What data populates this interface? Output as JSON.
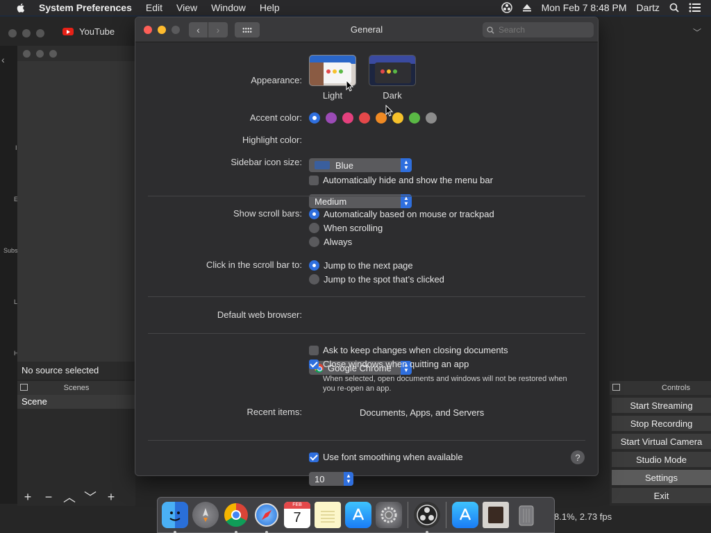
{
  "menubar": {
    "app_name": "System Preferences",
    "menus": [
      "Edit",
      "View",
      "Window",
      "Help"
    ],
    "clock": "Mon Feb 7  8:48 PM",
    "user": "Dartz"
  },
  "obs": {
    "tab_title": "YouTube",
    "left_strip_labels": [
      "I",
      "E",
      "Subs",
      "L",
      "H"
    ],
    "source_status": "No source selected",
    "scenes_header": "Scenes",
    "scenes": [
      "Scene"
    ],
    "controls_header": "Controls",
    "controls": [
      "Start Streaming",
      "Stop Recording",
      "Start Virtual Camera",
      "Studio Mode",
      "Settings",
      "Exit"
    ],
    "status_text": "8.1%, 2.73 fps",
    "scene_toolbar": [
      "+",
      "−",
      "︿",
      "﹀",
      "+"
    ]
  },
  "prefs": {
    "title": "General",
    "search_placeholder": "Search",
    "appearance": {
      "label": "Appearance:",
      "options": [
        {
          "name": "Light",
          "selected": true
        },
        {
          "name": "Dark",
          "selected": false
        }
      ]
    },
    "accent": {
      "label": "Accent color:",
      "colors": [
        "#2f6fde",
        "#9b4bb6",
        "#e4407d",
        "#e4484a",
        "#f08a24",
        "#f6c12b",
        "#5ab845",
        "#8c8c8c"
      ],
      "selected_index": 0
    },
    "highlight": {
      "label": "Highlight color:",
      "value": "Blue"
    },
    "sidebar_icon_size": {
      "label": "Sidebar icon size:",
      "value": "Medium"
    },
    "auto_hide_menu": {
      "label": "Automatically hide and show the menu bar",
      "checked": false
    },
    "scroll_bars": {
      "label": "Show scroll bars:",
      "options": [
        "Automatically based on mouse or trackpad",
        "When scrolling",
        "Always"
      ],
      "selected_index": 0
    },
    "click_scroll": {
      "label": "Click in the scroll bar to:",
      "options": [
        "Jump to the next page",
        "Jump to the spot that’s clicked"
      ],
      "selected_index": 0
    },
    "browser": {
      "label": "Default web browser:",
      "value": "Google Chrome"
    },
    "ask_keep_changes": {
      "label": "Ask to keep changes when closing documents",
      "checked": false
    },
    "close_windows": {
      "label": "Close windows when quitting an app",
      "checked": true
    },
    "close_windows_note": "When selected, open documents and windows will not be restored when you re-open an app.",
    "recent_items": {
      "label": "Recent items:",
      "value": "10",
      "suffix": "Documents, Apps, and Servers"
    },
    "font_smoothing": {
      "label": "Use font smoothing when available",
      "checked": true
    },
    "help": "?"
  },
  "dock": {
    "apps": [
      "finder-icon",
      "launchpad-icon",
      "chrome-icon",
      "safari-icon",
      "calendar-icon",
      "notes-icon",
      "app-store-icon",
      "system-preferences-icon",
      "obs-icon",
      "app-store-icon-2",
      "preview-folder-icon",
      "trash-icon"
    ],
    "calendar": {
      "month": "FEB",
      "day": "7"
    }
  }
}
